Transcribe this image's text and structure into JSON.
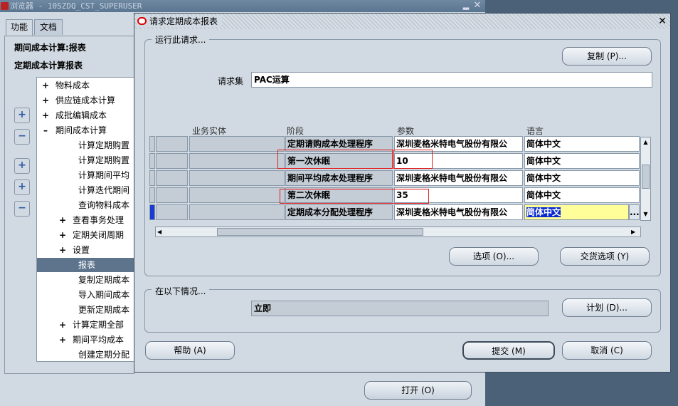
{
  "nav": {
    "title": "浏览器 - 10SZDQ_CST_SUPERUSER",
    "tabs": [
      "功能",
      "文档"
    ],
    "heading1": "期间成本计算:报表",
    "heading2": "定期成本计算报表",
    "tree": [
      {
        "pm": "+",
        "label": "物料成本",
        "level": 0
      },
      {
        "pm": "+",
        "label": "供应链成本计算",
        "level": 0
      },
      {
        "pm": "+",
        "label": "成批编辑成本",
        "level": 0
      },
      {
        "pm": "–",
        "label": "期间成本计算",
        "level": 0
      },
      {
        "pm": "",
        "label": "计算定期购置",
        "level": 2
      },
      {
        "pm": "",
        "label": "计算定期购置",
        "level": 2
      },
      {
        "pm": "",
        "label": "计算期间平均",
        "level": 2
      },
      {
        "pm": "",
        "label": "计算迭代期间",
        "level": 2
      },
      {
        "pm": "",
        "label": "查询物料成本",
        "level": 2
      },
      {
        "pm": "+",
        "label": "查看事务处理",
        "level": 1
      },
      {
        "pm": "+",
        "label": "定期关闭周期",
        "level": 1
      },
      {
        "pm": "+",
        "label": "设置",
        "level": 1
      },
      {
        "pm": "",
        "label": "报表",
        "level": 2,
        "selected": true
      },
      {
        "pm": "",
        "label": "复制定期成本",
        "level": 2
      },
      {
        "pm": "",
        "label": "导入期间成本",
        "level": 2
      },
      {
        "pm": "",
        "label": "更新定期成本",
        "level": 2
      },
      {
        "pm": "+",
        "label": "计算定期全部",
        "level": 1
      },
      {
        "pm": "+",
        "label": "期间平均成本",
        "level": 1
      },
      {
        "pm": "",
        "label": "创建定期分配",
        "level": 2
      }
    ],
    "open_button": "打开 (O)"
  },
  "dialog": {
    "title": "请求定期成本报表",
    "run_group_label": "运行此请求...",
    "copy_button": "复制 (P)...",
    "request_set_label": "请求集",
    "request_set_value": "PAC运算",
    "columns": [
      "业务实体",
      "阶段",
      "参数",
      "语言"
    ],
    "rows": [
      {
        "entity": "",
        "stage": "定期请购成本处理程序",
        "param": "深圳麦格米特电气股份有限公",
        "lang": "简体中文"
      },
      {
        "entity": "",
        "stage": "第一次休眠",
        "param": "10",
        "lang": "简体中文"
      },
      {
        "entity": "",
        "stage": "期间平均成本处理程序",
        "param": "深圳麦格米特电气股份有限公",
        "lang": "简体中文"
      },
      {
        "entity": "",
        "stage": "第二次休眠",
        "param": "35",
        "lang": "简体中文"
      },
      {
        "entity": "",
        "stage": "定期成本分配处理程序",
        "param": "深圳麦格米特电气股份有限公",
        "lang": "简体中文"
      }
    ],
    "ellipsis_button": "...",
    "options_button": "选项 (O)...",
    "delivery_button": "交货选项 (Y)",
    "when_group_label": "在以下情况...",
    "schedule_value": "立即",
    "schedule_button": "计划 (D)...",
    "help_button": "帮助 (A)",
    "submit_button": "提交 (M)",
    "cancel_button": "取消 (C)"
  },
  "colors": {
    "desktop": "#4b6178",
    "panel": "#d1d9e2",
    "selected_lang_bg": "#fffe99",
    "highlight": "#0a2ad0",
    "annotation_red": "#e02020"
  }
}
